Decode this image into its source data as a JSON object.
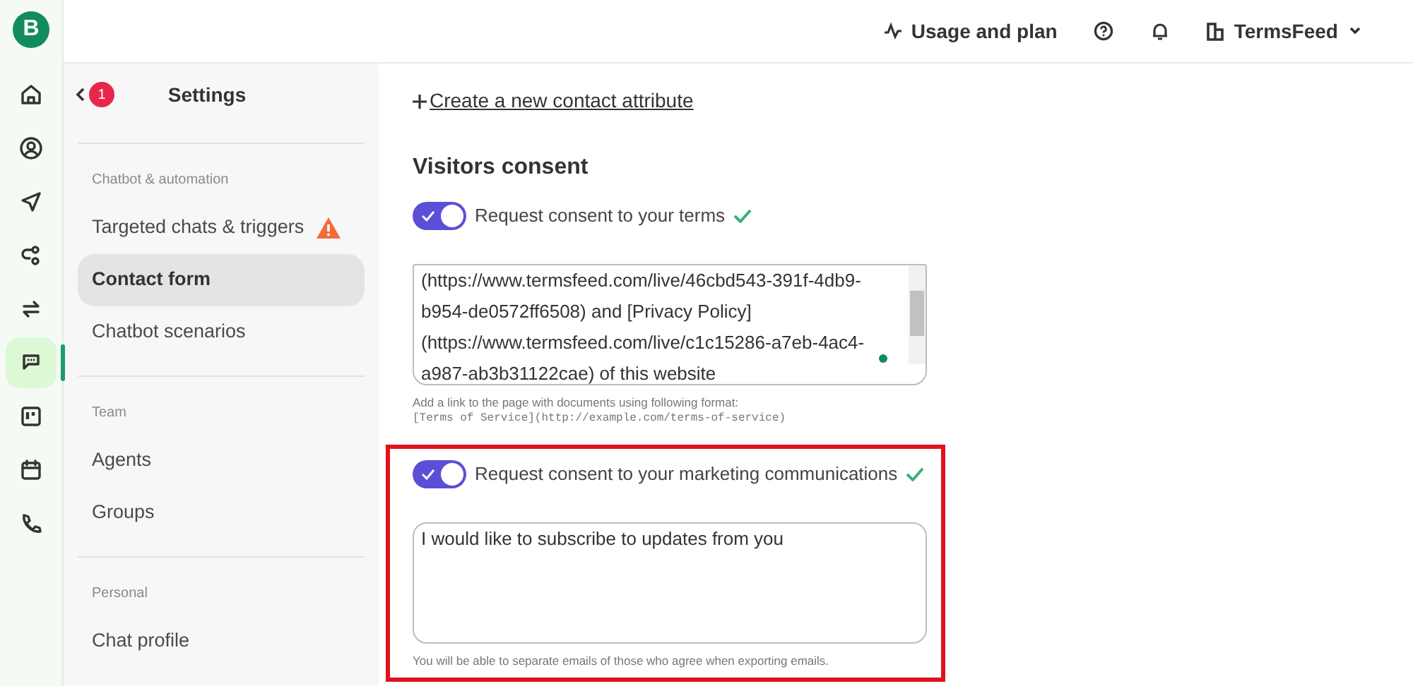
{
  "app_logo": {
    "letter": "B"
  },
  "rail": [
    {
      "kind": "home",
      "selected": false
    },
    {
      "kind": "contacts",
      "selected": false
    },
    {
      "kind": "send",
      "selected": false
    },
    {
      "kind": "flows",
      "selected": false
    },
    {
      "kind": "sync",
      "selected": false
    },
    {
      "kind": "chat",
      "selected": true
    },
    {
      "kind": "board",
      "selected": false
    },
    {
      "kind": "calendar",
      "selected": false
    },
    {
      "kind": "phone",
      "selected": false
    }
  ],
  "header": {
    "usage": "Usage and plan",
    "account": "TermsFeed"
  },
  "sidebar": {
    "back_badge": "1",
    "title": "Settings",
    "sections": [
      {
        "heading": "Chatbot & automation",
        "items": [
          {
            "label": "Targeted chats & triggers",
            "selected": false,
            "warning": true
          },
          {
            "label": "Contact form",
            "selected": true,
            "warning": false
          },
          {
            "label": "Chatbot scenarios",
            "selected": false,
            "warning": false
          }
        ]
      },
      {
        "heading": "Team",
        "items": [
          {
            "label": "Agents",
            "selected": false,
            "warning": false
          },
          {
            "label": "Groups",
            "selected": false,
            "warning": false
          }
        ]
      },
      {
        "heading": "Personal",
        "items": [
          {
            "label": "Chat profile",
            "selected": false,
            "warning": false
          }
        ]
      }
    ]
  },
  "main": {
    "create_link": "Create a new contact attribute",
    "section_title": "Visitors consent",
    "consents": [
      {
        "label": "Request consent to your terms",
        "on": true,
        "highlighted": false,
        "scrollable": true,
        "text_lines": [
          "(https://www.termsfeed.com/live/46cbd543-391f-4db9-",
          "b954-de0572ff6508) and [Privacy Policy]",
          "(https://www.termsfeed.com/live/c1c15286-a7eb-4ac4-",
          "a987-ab3b31122cae) of this website"
        ],
        "help": [
          "Add a link to the page with documents using following format:",
          "[Terms of Service](http://example.com/terms-of-service)"
        ]
      },
      {
        "label": "Request consent to your marketing communications",
        "on": true,
        "highlighted": true,
        "scrollable": false,
        "text_lines": [
          "I would like to subscribe to updates from you"
        ],
        "help": [
          "You will be able to separate emails of those who agree when exporting emails."
        ]
      }
    ]
  }
}
